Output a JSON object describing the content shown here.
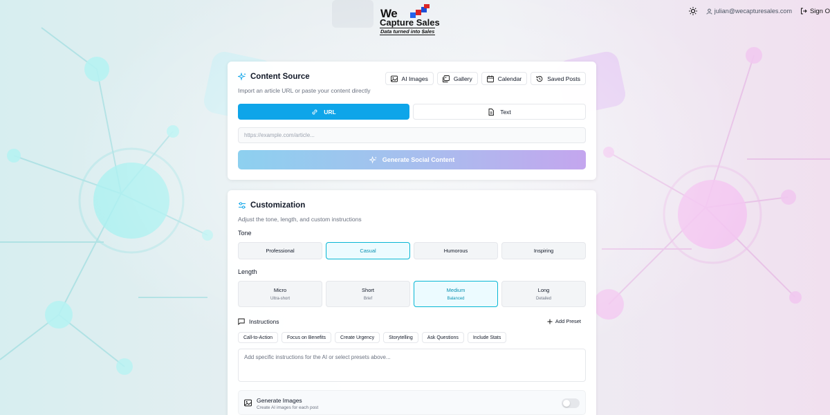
{
  "header": {
    "logo_we": "We",
    "logo_capture": "Capture Sales",
    "logo_tagline": "Data turned into $ales",
    "user_email": "julian@wecapturesales.com",
    "sign_out_label": "Sign O"
  },
  "content_source": {
    "title": "Content Source",
    "subtitle": "Import an article URL or paste your content directly",
    "toolbar": {
      "ai_images": "AI Images",
      "gallery": "Gallery",
      "calendar": "Calendar",
      "saved_posts": "Saved Posts"
    },
    "mode_url": "URL",
    "mode_text": "Text",
    "url_placeholder": "https://example.com/article...",
    "url_value": "",
    "generate_label": "Generate Social Content"
  },
  "customization": {
    "title": "Customization",
    "subtitle": "Adjust the tone, length, and custom instructions",
    "tone_label": "Tone",
    "tones": [
      "Professional",
      "Casual",
      "Humorous",
      "Inspiring"
    ],
    "selected_tone": "Casual",
    "length_label": "Length",
    "lengths": [
      {
        "name": "Micro",
        "desc": "Ultra-short"
      },
      {
        "name": "Short",
        "desc": "Brief"
      },
      {
        "name": "Medium",
        "desc": "Balanced"
      },
      {
        "name": "Long",
        "desc": "Detailed"
      }
    ],
    "selected_length": "Medium",
    "instructions_label": "Instructions",
    "add_preset_label": "Add Preset",
    "presets": [
      "Call-to-Action",
      "Focus on Benefits",
      "Create Urgency",
      "Storytelling",
      "Ask Questions",
      "Include Stats"
    ],
    "instructions_placeholder": "Add specific instructions for the AI or select presets above...",
    "generate_images_title": "Generate Images",
    "generate_images_sub": "Create AI images for each post",
    "generate_images_enabled": false
  },
  "colors": {
    "accent": "#0ea5e9",
    "selected_border": "#06b6d4"
  }
}
